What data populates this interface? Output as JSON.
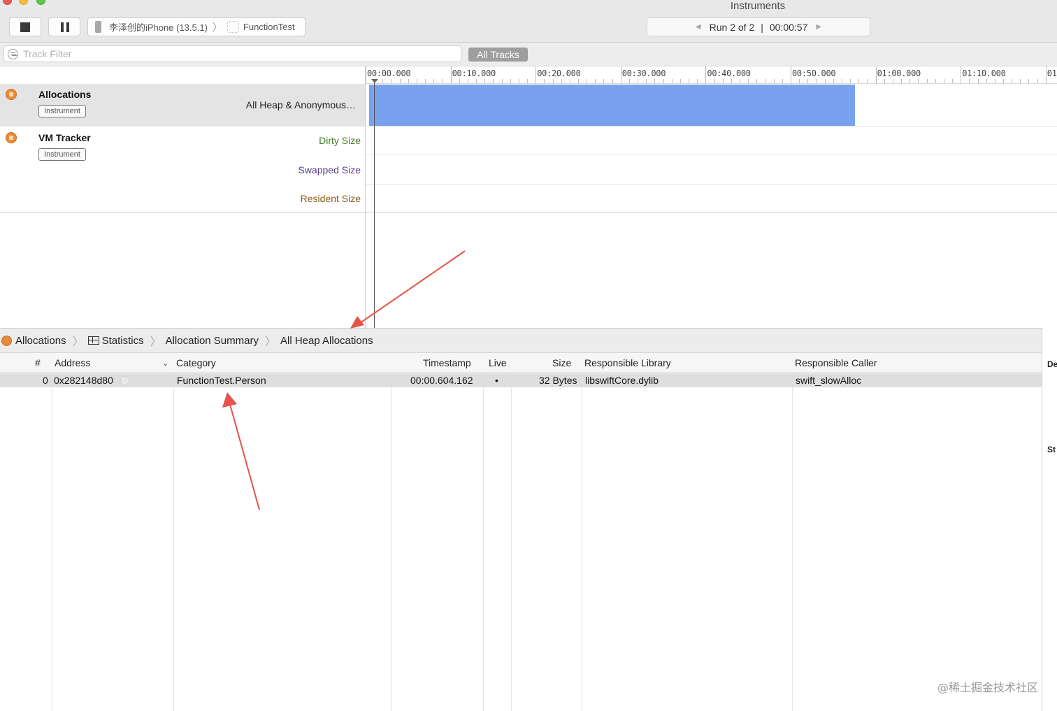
{
  "window": {
    "title": "Instruments"
  },
  "toolbar": {
    "device": "李泽创的iPhone (13.5.1)",
    "app": "FunctionTest",
    "run_label": "Run 2 of 2",
    "run_sep": "|",
    "elapsed": "00:00:57"
  },
  "filter": {
    "placeholder": "Track Filter",
    "all_tracks": "All Tracks"
  },
  "timeline": {
    "ticks": [
      "00:00.000",
      "00:10.000",
      "00:20.000",
      "00:30.000",
      "00:40.000",
      "00:50.000",
      "01:00.000",
      "01:10.000",
      "01"
    ]
  },
  "instruments": [
    {
      "name": "Allocations",
      "tag": "Instrument",
      "tracks": [
        {
          "label": "All Heap & Anonymous…",
          "color": "#222222"
        }
      ]
    },
    {
      "name": "VM Tracker",
      "tag": "Instrument",
      "tracks": [
        {
          "label": "Dirty Size",
          "color": "#3f7d2a"
        },
        {
          "label": "Swapped Size",
          "color": "#5b3f8f"
        },
        {
          "label": "Resident Size",
          "color": "#8a5a17"
        }
      ]
    }
  ],
  "jumpbar": {
    "items": [
      "Allocations",
      "Statistics",
      "Allocation Summary",
      "All Heap Allocations"
    ]
  },
  "table": {
    "headers": [
      "#",
      "Address",
      "Category",
      "Timestamp",
      "Live",
      "Size",
      "Responsible Library",
      "Responsible Caller"
    ],
    "rows": [
      {
        "index": "0",
        "address": "0x282148d80",
        "category": "FunctionTest.Person",
        "timestamp": "00:00.604.162",
        "live": "•",
        "size": "32 Bytes",
        "library": "libswiftCore.dylib",
        "caller": "swift_slowAlloc"
      }
    ]
  },
  "inspector": {
    "label_top": "De",
    "label_mid": "St"
  },
  "watermark": "@稀土掘金技术社区",
  "colors": {
    "allocation_bar": "#79a2ee",
    "instrument_icon": "#e88b3a",
    "annotation_arrow": "#e5534b"
  }
}
